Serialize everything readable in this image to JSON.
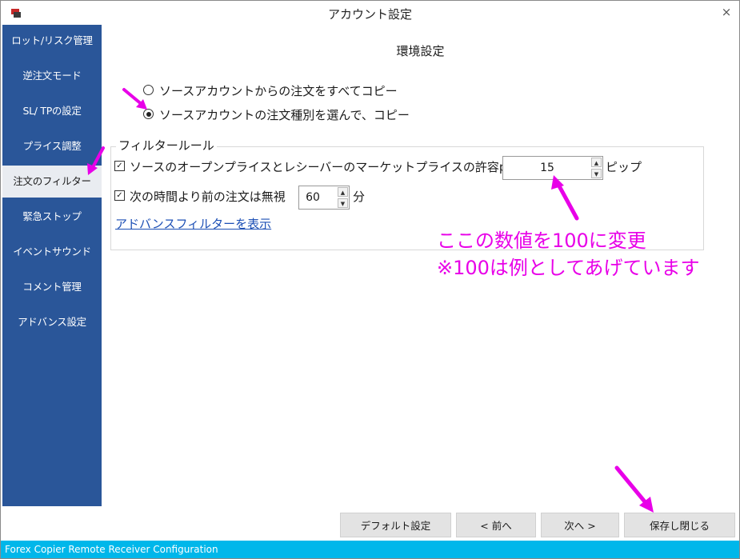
{
  "window": {
    "title": "アカウント設定",
    "close_glyph": "×"
  },
  "sidebar": {
    "items": [
      {
        "label": "ロット/リスク管理"
      },
      {
        "label": "逆注文モード"
      },
      {
        "label": "SL/ TPの設定"
      },
      {
        "label": "プライス調整"
      },
      {
        "label": "注文のフィルター",
        "active": true
      },
      {
        "label": "緊急ストップ"
      },
      {
        "label": "イベントサウンド"
      },
      {
        "label": "コメント管理"
      },
      {
        "label": "アドバンス設定"
      }
    ],
    "bg_color": "#2a5699"
  },
  "main": {
    "title": "環境設定",
    "radios": [
      {
        "label": "ソースアカウントからの注文をすべてコピー",
        "checked": false
      },
      {
        "label": "ソースアカウントの注文種別を選んで、コピー",
        "checked": true
      }
    ],
    "filter_group": {
      "legend": "フィルタールール",
      "rule1": {
        "label": "ソースのオープンプライスとレシーバーのマーケットプライスの許容pips差",
        "checked": true,
        "value": "15",
        "unit": "ピップ"
      },
      "rule2": {
        "label": "次の時間より前の注文は無視",
        "checked": true,
        "value": "60",
        "unit": "分"
      },
      "advanced_link": "アドバンスフィルターを表示"
    }
  },
  "annotation": {
    "line1": "ここの数値を100に変更",
    "line2": "※100は例としてあげています",
    "color": "#e800e8"
  },
  "buttons": {
    "default": "デフォルト設定",
    "prev": "< 前へ",
    "next": "次へ >",
    "save_close": "保存し閉じる"
  },
  "statusbar": {
    "text": "Forex Copier Remote Receiver Configuration",
    "color": "#00b7ea"
  },
  "icons": {
    "app": "app-icon",
    "close": "close-icon",
    "spin_up": "▲",
    "spin_down": "▼",
    "check": "✓"
  }
}
